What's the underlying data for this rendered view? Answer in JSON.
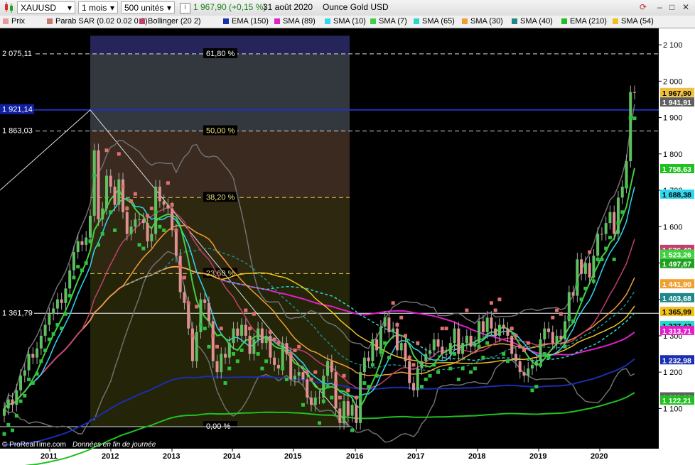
{
  "toolbar": {
    "symbol": "XAUUSD",
    "period": "1 mois",
    "units": "500 unités",
    "price": "1 967,90",
    "change": "(+0,15 %)",
    "date": "31 août 2020",
    "instrument": "Ounce Gold USD"
  },
  "legend": [
    {
      "label": "Prix",
      "color": "#e89a9a"
    },
    {
      "label": "Parab SAR (0.02 0.02 0.2)",
      "color": "#c8786e"
    },
    {
      "label": "Bollinger (20 2)",
      "color": "#c04070"
    },
    {
      "label": "EMA (150)",
      "color": "#1a2fb0"
    },
    {
      "label": "SMA (89)",
      "color": "#e020c8"
    },
    {
      "label": "SMA (10)",
      "color": "#30d8f0"
    },
    {
      "label": "SMA (7)",
      "color": "#40d040"
    },
    {
      "label": "SMA (65)",
      "color": "#28d8c8"
    },
    {
      "label": "SMA (30)",
      "color": "#f0a030"
    },
    {
      "label": "SMA (40)",
      "color": "#208888"
    },
    {
      "label": "EMA (210)",
      "color": "#20c020"
    },
    {
      "label": "SMA (54)",
      "color": "#f0c020"
    }
  ],
  "footer": {
    "copyright": "© ProRealTime.com",
    "note": "Données en fin de journée"
  },
  "chart_data": {
    "type": "candlestick",
    "x_ticks": [
      "2011",
      "2012",
      "2013",
      "2014",
      "2015",
      "2016",
      "2017",
      "2018",
      "2019",
      "2020"
    ],
    "y_ticks": [
      "2 100",
      "2 000",
      "1 900",
      "1 800",
      "1 700",
      "1 600",
      "1 500",
      "1 400",
      "1 300",
      "1 200",
      "1 100"
    ],
    "ylim": [
      1045,
      2125
    ],
    "fib_levels": [
      {
        "label": "61,80 %",
        "price": 2075.11,
        "price_label": "2 075,11"
      },
      {
        "label": "50,00 %",
        "price": 1863.03,
        "price_label": "1 863,03"
      },
      {
        "label": "38,20 %",
        "price": 1680
      },
      {
        "label": "23,60 %",
        "price": 1471
      },
      {
        "label": "0,00 %",
        "price": 1050
      }
    ],
    "horizontal_lines": [
      {
        "price": 1921.14,
        "label": "1 921,14",
        "color": "#2030c0"
      },
      {
        "price": 1361.79,
        "label": "1 361,79",
        "color": "#ffffff"
      }
    ],
    "price_tags": [
      {
        "value": 1967.9,
        "text": "1 967,90",
        "color": "#f0c040"
      },
      {
        "value": 1941.91,
        "text": "1 941,91",
        "color": "#606060"
      },
      {
        "value": 1758.63,
        "text": "1 758,63",
        "color": "#20c020"
      },
      {
        "value": 1688.38,
        "text": "1 688,38",
        "color": "#30d8f0"
      },
      {
        "value": 1536.4,
        "text": "1 536,40",
        "color": "#c04070"
      },
      {
        "value": 1523.26,
        "text": "1 523,26",
        "color": "#40d040"
      },
      {
        "value": 1497.67,
        "text": "1 497,67",
        "color": "#20a020"
      },
      {
        "value": 1441.9,
        "text": "1 441,90",
        "color": "#f0a030"
      },
      {
        "value": 1403.68,
        "text": "1 403,68",
        "color": "#208888"
      },
      {
        "value": 1365.99,
        "text": "1 365,99",
        "color": "#f0c020"
      },
      {
        "value": 1327.43,
        "text": "1 327,43",
        "color": "#28d8c8"
      },
      {
        "value": 1313.71,
        "text": "1 313,71",
        "color": "#e020c8"
      },
      {
        "value": 1232.98,
        "text": "1 232,98",
        "color": "#1a2fb0"
      },
      {
        "value": 1130.9,
        "text": "1 130,90",
        "color": "#606060"
      },
      {
        "value": 1122.21,
        "text": "1 122,21",
        "color": "#20c020"
      }
    ],
    "close_series": [
      1100,
      1125,
      1110,
      1150,
      1190,
      1205,
      1250,
      1240,
      1265,
      1300,
      1330,
      1360,
      1375,
      1400,
      1390,
      1430,
      1480,
      1530,
      1560,
      1550,
      1570,
      1630,
      1810,
      1620,
      1650,
      1740,
      1710,
      1660,
      1730,
      1640,
      1580,
      1600,
      1620,
      1620,
      1610,
      1560,
      1580,
      1710,
      1670,
      1660,
      1650,
      1590,
      1520,
      1420,
      1390,
      1320,
      1230,
      1310,
      1400,
      1390,
      1340,
      1230,
      1200,
      1250,
      1240,
      1280,
      1320,
      1300,
      1330,
      1300,
      1250,
      1290,
      1320,
      1280,
      1300,
      1240,
      1220,
      1210,
      1280,
      1250,
      1180,
      1190,
      1200,
      1180,
      1130,
      1110,
      1130,
      1130,
      1190,
      1230,
      1200,
      1100,
      1060,
      1120,
      1080,
      1110,
      1060,
      1200,
      1240,
      1230,
      1290,
      1260,
      1325,
      1350,
      1310,
      1320,
      1260,
      1280,
      1230,
      1170,
      1150,
      1210,
      1230,
      1250,
      1260,
      1290,
      1270,
      1250,
      1250,
      1280,
      1320,
      1250,
      1280,
      1300,
      1270,
      1280,
      1340,
      1310,
      1350,
      1320,
      1300,
      1330,
      1320,
      1300,
      1250,
      1230,
      1200,
      1190,
      1210,
      1220,
      1230,
      1290,
      1320,
      1310,
      1280,
      1300,
      1290,
      1340,
      1420,
      1410,
      1510,
      1470,
      1500,
      1460,
      1520,
      1580,
      1580,
      1610,
      1640,
      1580,
      1680,
      1710,
      1780,
      1970,
      1968
    ]
  }
}
